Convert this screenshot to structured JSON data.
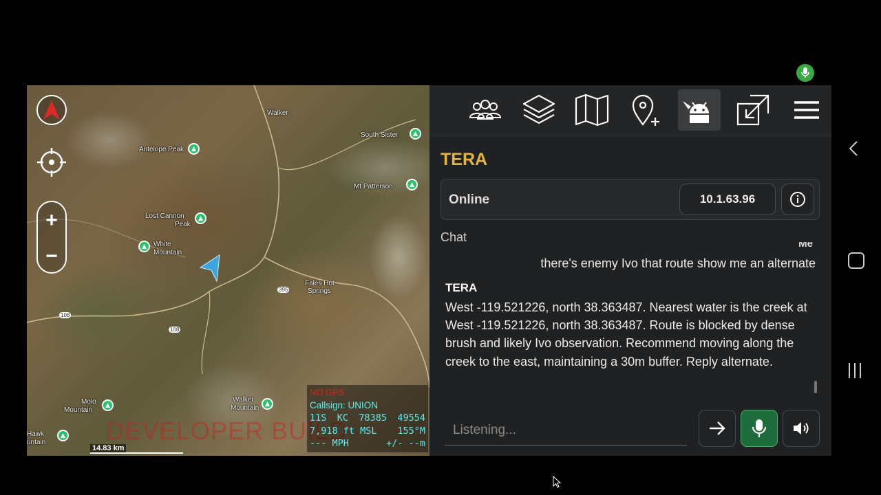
{
  "map": {
    "labels": {
      "walker_top": "Walker",
      "south_sister": "South Sister",
      "antelope_peak": "Antelope Peak",
      "mt_patterson": "Mt Patterson",
      "lost_cannon_peak_1": "Lost Cannon",
      "lost_cannon_peak_2": "Peak",
      "white_mountain_1": "White",
      "white_mountain_2": "Mountain",
      "fales_hot_springs_1": "Fales Hot",
      "fales_hot_springs_2": "Springs",
      "route_395": "395",
      "route_108_a": "108",
      "route_108_b": "108",
      "molo_mountain_1": "Molo",
      "molo_mountain_2": "Mountain",
      "walker_mountain_1": "Walker",
      "walker_mountain_2": "Mountain",
      "hawk_mountain_1": "Hawk",
      "hawk_mountain_2": "untain"
    },
    "watermark": "DEVELOPER BUILD",
    "scale": "14.83 km",
    "info": {
      "gps_status": "NO GPS",
      "callsign": "Callsign: UNION",
      "grid_zone": "11S",
      "grid_square": "KC",
      "easting": "78385",
      "northing": "49554",
      "altitude": "7,918 ft MSL",
      "heading": "155°M",
      "speed": "--- MPH",
      "accuracy": "+/- --m"
    },
    "handle": "||"
  },
  "panel": {
    "title": "TERA",
    "status": "Online",
    "ip": "10.1.63.96",
    "chat_label": "Chat",
    "messages": {
      "me_sender": "Me",
      "me_text": "there's enemy Ivo that route show me an alternate",
      "tera_sender": "TERA",
      "tera_text": "West -119.521226, north 38.363487. Nearest water is the creek at West -119.521226, north 38.363487. Route is blocked by dense brush and likely Ivo observation. Recommend moving along the creek to the east, maintaining a 30m buffer. Reply alternate."
    },
    "input": {
      "placeholder": "Listening..."
    }
  },
  "colors": {
    "accent_title": "#e3b440",
    "mic_active": "#1e6b3c",
    "info_text": "#55f0f0",
    "gps_warning": "#e02020",
    "peak_marker": "#27c26a",
    "self_marker": "#3aa6dd"
  },
  "icons": {
    "toolbar": [
      "contacts-icon",
      "layers-icon",
      "map-icon",
      "add-point-icon",
      "android-plugin-icon",
      "expand-icon",
      "menu-icon"
    ],
    "map_controls": [
      "compass-icon",
      "locate-icon",
      "zoom-in-icon",
      "zoom-out-icon"
    ]
  }
}
